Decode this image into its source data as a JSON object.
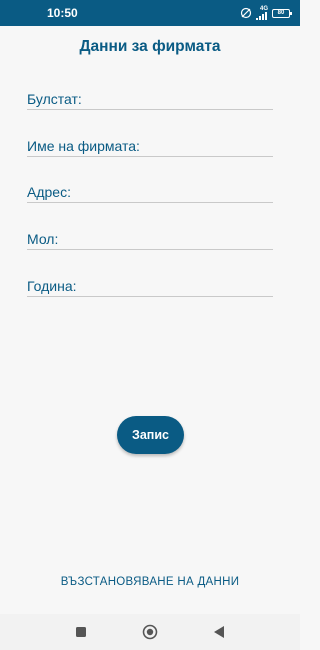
{
  "status_bar": {
    "time": "10:50",
    "network_label": "4G",
    "battery_level": "80",
    "icons": [
      "do-not-disturb-icon",
      "signal-icon",
      "battery-icon"
    ]
  },
  "page": {
    "title": "Данни за фирмата"
  },
  "form": {
    "fields": [
      {
        "label": "Булстат:",
        "value": ""
      },
      {
        "label": "Име на фирмата:",
        "value": ""
      },
      {
        "label": "Адрес:",
        "value": ""
      },
      {
        "label": "Мол:",
        "value": ""
      },
      {
        "label": "Година:",
        "value": ""
      }
    ]
  },
  "actions": {
    "save_label": "Запис",
    "restore_label": "ВЪЗСТАНОВЯВАНЕ НА ДАННИ"
  },
  "nav_bar": {
    "icons": [
      "recents-icon",
      "home-icon",
      "back-icon"
    ]
  },
  "colors": {
    "accent": "#0a5b84",
    "background": "#f7f7f7"
  }
}
